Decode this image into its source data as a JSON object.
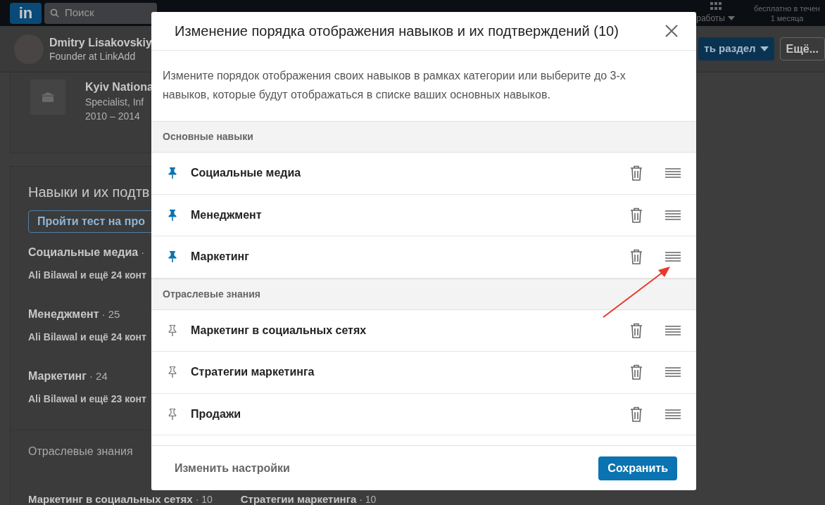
{
  "nav": {
    "logo": "in",
    "search_placeholder": "Поиск",
    "work_label": "работы",
    "premium_lines": [
      "бесплатно в течен",
      "1 месяца"
    ]
  },
  "profile": {
    "name": "Dmitry Lisakovskiy",
    "headline": "Founder at LinkAdd",
    "add_section": "ть раздел",
    "more": "Ещё..."
  },
  "education": {
    "school": "Kyiv Nationa",
    "degree": "Specialist, Inf",
    "years": "2010 – 2014"
  },
  "skills_section": {
    "title": "Навыки и их подтв",
    "quiz_button": "Пройти тест на про",
    "skills": [
      {
        "name": "Социальные медиа",
        "count": "·",
        "endorsers": "Ali Bilawal и ещё 24 конт"
      },
      {
        "name": "Менеджмент",
        "count": "· 25",
        "endorsers": "Ali Bilawal и ещё 24 конт"
      },
      {
        "name": "Маркетинг",
        "count": "· 24",
        "endorsers": "Ali Bilawal и ещё 23 конт"
      }
    ],
    "industry_title": "Отраслевые знания",
    "industry_skills": [
      {
        "name": "Маркетинг в социальных сетях",
        "count": "· 10"
      },
      {
        "name": "Стратегии маркетинга",
        "count": "· 10"
      }
    ]
  },
  "modal": {
    "title": "Изменение порядка отображения навыков и их подтверждений (10)",
    "description": "Измените порядок отображения своих навыков в рамках категории или выберите до 3-х навыков, которые будут отображаться в списке ваших основных навыков.",
    "groups": [
      {
        "title": "Основные навыки",
        "skills": [
          {
            "name": "Социальные медиа",
            "pinned": true
          },
          {
            "name": "Менеджмент",
            "pinned": true
          },
          {
            "name": "Маркетинг",
            "pinned": true
          }
        ]
      },
      {
        "title": "Отраслевые знания",
        "skills": [
          {
            "name": "Маркетинг в социальных сетях",
            "pinned": false
          },
          {
            "name": "Стратегии маркетинга",
            "pinned": false
          },
          {
            "name": "Продажи",
            "pinned": false
          }
        ]
      }
    ],
    "settings_link": "Изменить настройки",
    "save_button": "Сохранить"
  }
}
